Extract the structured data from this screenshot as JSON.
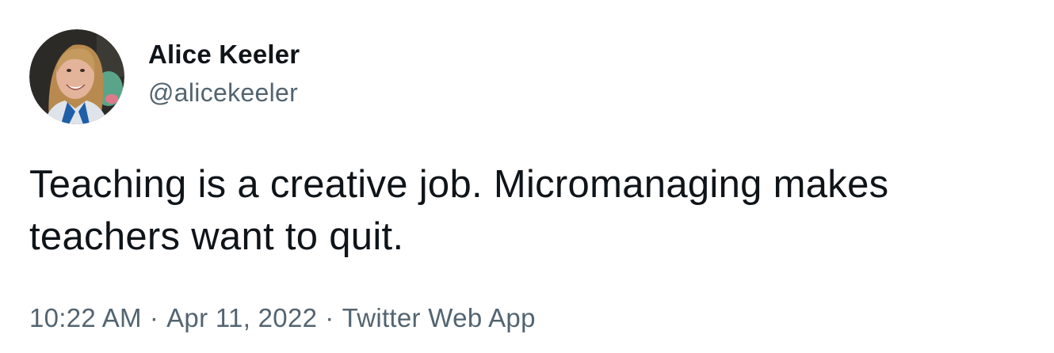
{
  "tweet": {
    "author": {
      "display_name": "Alice Keeler",
      "handle": "@alicekeeler"
    },
    "text": "Teaching is a creative job. Micromanaging makes\nteachers want to quit.",
    "meta": {
      "time": "10:22 AM",
      "separator": "·",
      "date": "Apr 11, 2022",
      "source": "Twitter Web App"
    }
  },
  "colors": {
    "text_primary": "#0f1419",
    "text_secondary": "#536471",
    "background": "#ffffff"
  }
}
